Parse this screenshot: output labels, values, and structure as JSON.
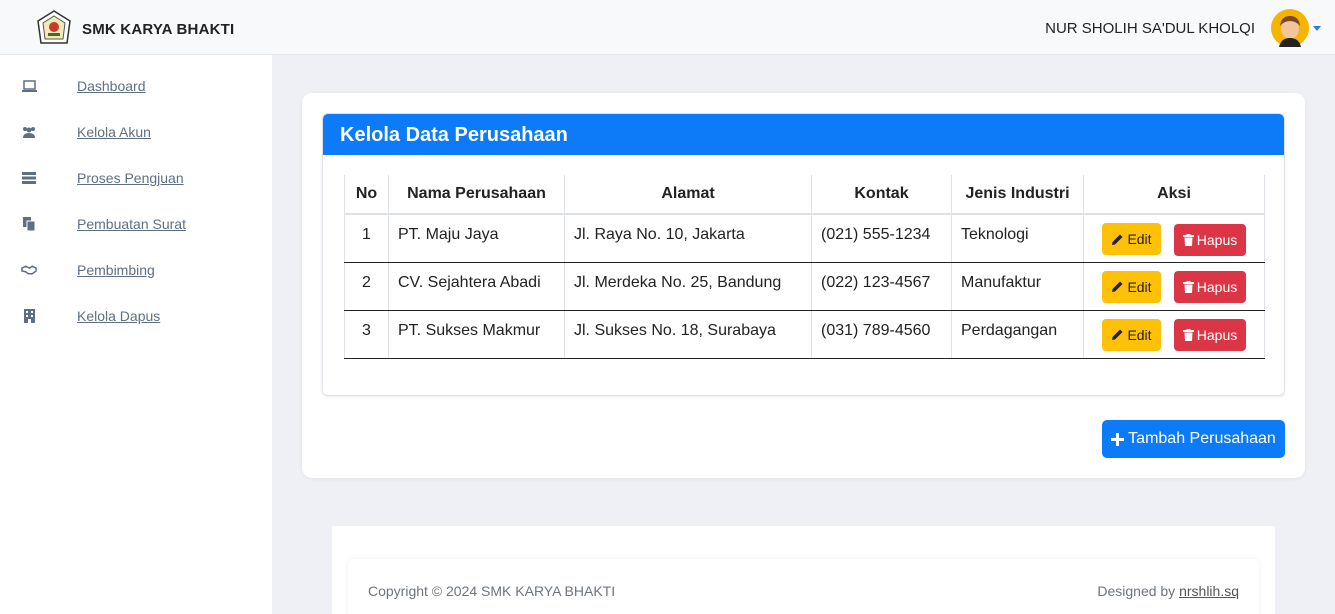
{
  "app": {
    "title": "SMK KARYA BHAKTI"
  },
  "user": {
    "name": "NUR SHOLIH SA'DUL KHOLQI"
  },
  "sidebar": {
    "items": [
      {
        "label": "Dashboard",
        "icon": "laptop-icon"
      },
      {
        "label": "Kelola Akun",
        "icon": "users-icon"
      },
      {
        "label": "Proses Pengjuan",
        "icon": "list-icon"
      },
      {
        "label": "Pembuatan Surat",
        "icon": "copy-icon"
      },
      {
        "label": "Pembimbing",
        "icon": "handshake-icon"
      },
      {
        "label": "Kelola Dapus",
        "icon": "building-icon"
      }
    ]
  },
  "main": {
    "card_title": "Kelola Data Perusahaan",
    "table": {
      "headers": [
        "No",
        "Nama Perusahaan",
        "Alamat",
        "Kontak",
        "Jenis Industri",
        "Aksi"
      ],
      "rows": [
        {
          "no": "1",
          "nama": "PT. Maju Jaya",
          "alamat": "Jl. Raya No. 10, Jakarta",
          "kontak": "(021) 555-1234",
          "jenis": "Teknologi"
        },
        {
          "no": "2",
          "nama": "CV. Sejahtera Abadi",
          "alamat": "Jl. Merdeka No. 25, Bandung",
          "kontak": "(022) 123-4567",
          "jenis": "Manufaktur"
        },
        {
          "no": "3",
          "nama": "PT. Sukses Makmur",
          "alamat": "Jl. Sukses No. 18, Surabaya",
          "kontak": "(031) 789-4560",
          "jenis": "Perdagangan"
        }
      ],
      "edit_label": "Edit",
      "delete_label": "Hapus"
    },
    "add_button": "Tambah Perusahaan"
  },
  "footer": {
    "copyright": "Copyright © 2024 SMK KARYA BHAKTI",
    "designed_prefix": "Designed by",
    "designed_link": "nrshlih.sq"
  },
  "colors": {
    "primary": "#0d7bf7",
    "warning": "#ffc107",
    "danger": "#dc3545"
  }
}
